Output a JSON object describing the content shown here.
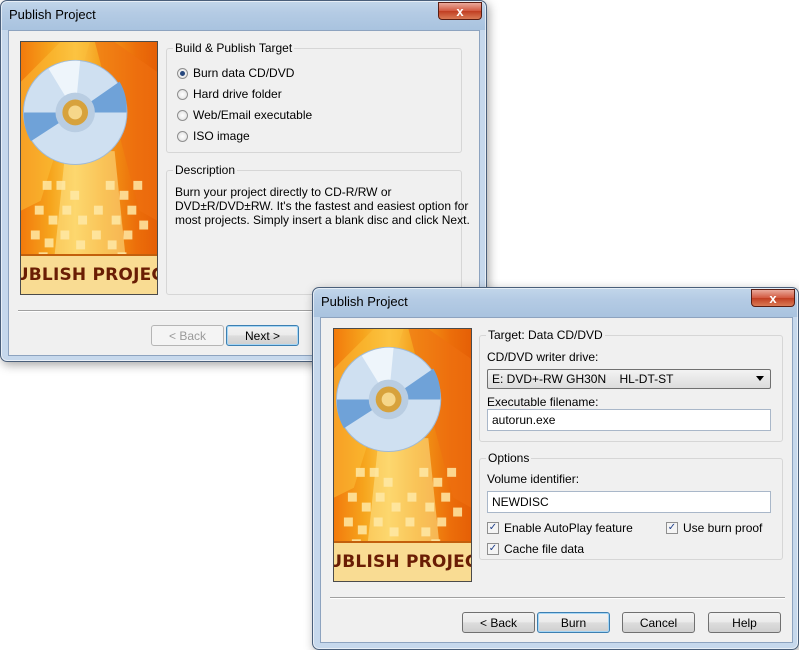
{
  "win1": {
    "title": "Publish Project",
    "close": "x",
    "banner_label": "PUBLISH PROJECT",
    "target_group": {
      "legend": "Build & Publish Target",
      "options": [
        "Burn data CD/DVD",
        "Hard drive folder",
        "Web/Email executable",
        "ISO image"
      ],
      "selected_index": 0
    },
    "description": {
      "legend": "Description",
      "lines": [
        "Burn your project directly to CD-R/RW or",
        "DVD±R/DVD±RW. It's the fastest and easiest option for",
        "most projects. Simply insert a blank disc and click Next."
      ]
    },
    "buttons": {
      "back": "< Back",
      "next": "Next >"
    }
  },
  "win2": {
    "title": "Publish Project",
    "close": "x",
    "banner_label": "PUBLISH PROJECT",
    "target_group": {
      "legend": "Target: Data CD/DVD",
      "drive_label": "CD/DVD writer drive:",
      "drive_value": "E: DVD+-RW GH30N    HL-DT-ST",
      "exe_label": "Executable filename:",
      "exe_value": "autorun.exe"
    },
    "options_group": {
      "legend": "Options",
      "volume_label": "Volume identifier:",
      "volume_value": "NEWDISC",
      "autoplay": {
        "label": "Enable AutoPlay feature",
        "checked": true
      },
      "burnproof": {
        "label": "Use burn proof",
        "checked": true
      },
      "cache": {
        "label": "Cache file data",
        "checked": true
      }
    },
    "buttons": {
      "back": "< Back",
      "burn": "Burn",
      "cancel": "Cancel",
      "help": "Help"
    }
  },
  "colors": {
    "title_bar": "#b4cbe4",
    "close_button": "#c13e22",
    "banner_orange": "#f27a0c",
    "default_button_border": "#3c7fb1"
  }
}
